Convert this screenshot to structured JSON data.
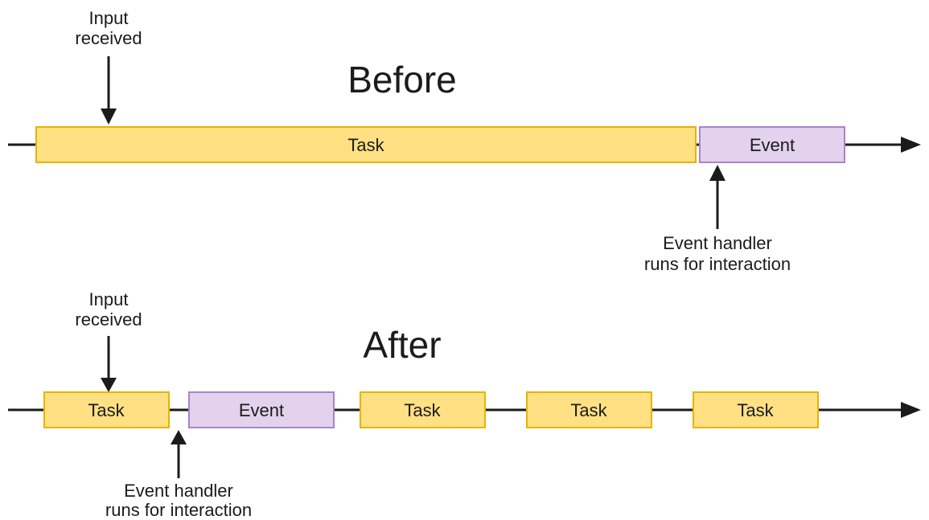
{
  "before": {
    "title": "Before",
    "input_label_l1": "Input",
    "input_label_l2": "received",
    "handler_label_l1": "Event handler",
    "handler_label_l2": "runs for interaction",
    "blocks": [
      {
        "label": "Task",
        "kind": "task"
      },
      {
        "label": "Event",
        "kind": "event"
      }
    ]
  },
  "after": {
    "title": "After",
    "input_label_l1": "Input",
    "input_label_l2": "received",
    "handler_label_l1": "Event handler",
    "handler_label_l2": "runs for interaction",
    "blocks": [
      {
        "label": "Task",
        "kind": "task"
      },
      {
        "label": "Event",
        "kind": "event"
      },
      {
        "label": "Task",
        "kind": "task"
      },
      {
        "label": "Task",
        "kind": "task"
      },
      {
        "label": "Task",
        "kind": "task"
      }
    ]
  }
}
